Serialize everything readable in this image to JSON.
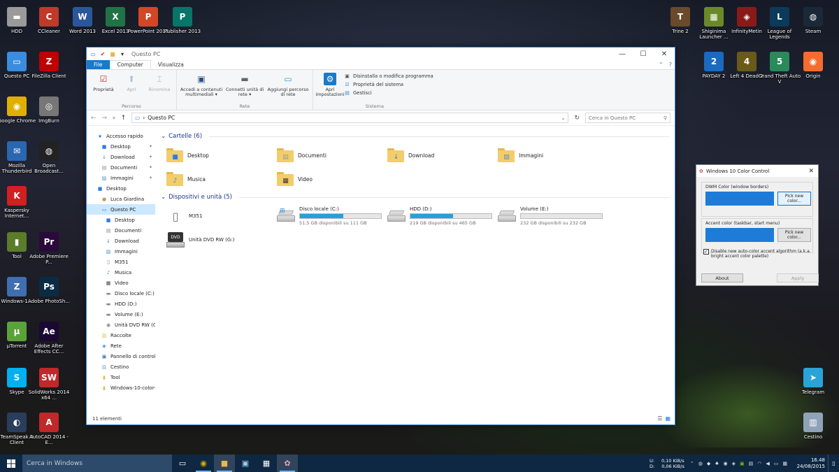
{
  "desktop": {
    "left_icons": [
      {
        "label": "HDD",
        "color": "#9a9a9a",
        "glyph": "▬"
      },
      {
        "label": "CCleaner",
        "color": "#c0392b",
        "glyph": "C"
      },
      {
        "label": "Word 2013",
        "color": "#2b579a",
        "glyph": "W"
      },
      {
        "label": "Excel 2013",
        "color": "#217346",
        "glyph": "X"
      },
      {
        "label": "PowerPoint 2013",
        "color": "#d24726",
        "glyph": "P"
      },
      {
        "label": "Publisher 2013",
        "color": "#077568",
        "glyph": "P"
      },
      {
        "label": "Questo PC",
        "color": "#3a8dde",
        "glyph": "▭"
      },
      {
        "label": "FileZilla Client",
        "color": "#bf0000",
        "glyph": "Z"
      },
      {
        "label": "Google Chrome",
        "color": "#e0b000",
        "glyph": "◉"
      },
      {
        "label": "ImgBurn",
        "color": "#777",
        "glyph": "◎"
      },
      {
        "label": "Mozilla Thunderbird",
        "color": "#2a67b1",
        "glyph": "✉"
      },
      {
        "label": "Open Broadcast...",
        "color": "#222",
        "glyph": "◍"
      },
      {
        "label": "Kaspersky Internet...",
        "color": "#d02020",
        "glyph": "K"
      },
      {
        "label": "Tool",
        "color": "#5b7c2a",
        "glyph": "▮"
      },
      {
        "label": "Adobe Premiere P...",
        "color": "#2a0a3a",
        "glyph": "Pr"
      },
      {
        "label": "Windows-1...",
        "color": "#3f6fb0",
        "glyph": "Z"
      },
      {
        "label": "Adobe PhotoSh...",
        "color": "#0b2a44",
        "glyph": "Ps"
      },
      {
        "label": "µTorrent",
        "color": "#5aa33a",
        "glyph": "µ"
      },
      {
        "label": "Adobe After Effects CC...",
        "color": "#1a0a33",
        "glyph": "Ae"
      },
      {
        "label": "Skype",
        "color": "#00aff0",
        "glyph": "S"
      },
      {
        "label": "SolidWorks 2014 x64 ...",
        "color": "#c0282a",
        "glyph": "SW"
      },
      {
        "label": "TeamSpeak 3 Client",
        "color": "#2a3d5c",
        "glyph": "◐"
      },
      {
        "label": "AutoCAD 2014 - E...",
        "color": "#c0282a",
        "glyph": "A"
      }
    ],
    "right_icons": [
      {
        "label": "Trine 2",
        "color": "#6a4a2a",
        "glyph": "T"
      },
      {
        "label": "Shiginima Launcher ...",
        "color": "#6a8a2a",
        "glyph": "▦"
      },
      {
        "label": "InfinityMetin",
        "color": "#8a1a1a",
        "glyph": "◈"
      },
      {
        "label": "League of Legends",
        "color": "#0b3a5a",
        "glyph": "L"
      },
      {
        "label": "Steam",
        "color": "#1b2838",
        "glyph": "◍"
      },
      {
        "label": "PAYDAY 2",
        "color": "#1a6ac0",
        "glyph": "2"
      },
      {
        "label": "Left 4 Dead 2",
        "color": "#6a5a1a",
        "glyph": "4"
      },
      {
        "label": "Grand Theft Auto V",
        "color": "#2a8a5a",
        "glyph": "5"
      },
      {
        "label": "Origin",
        "color": "#f56c2d",
        "glyph": "◉"
      },
      {
        "label": "Telegram",
        "color": "#2aa3d9",
        "glyph": "➤"
      },
      {
        "label": "Cestino",
        "color": "#8fa3b8",
        "glyph": "▥"
      }
    ]
  },
  "explorer": {
    "title": "Questo PC",
    "tabs": {
      "file": "File",
      "computer": "Computer",
      "view": "Visualizza"
    },
    "ribbon": {
      "groups": [
        {
          "label": "Percorso",
          "buttons": [
            {
              "label": "Proprietà",
              "icon": "properties-icon",
              "disabled": false
            },
            {
              "label": "Apri",
              "icon": "open-icon",
              "disabled": true
            },
            {
              "label": "Rinomina",
              "icon": "rename-icon",
              "disabled": true
            }
          ]
        },
        {
          "label": "Rete",
          "buttons": [
            {
              "label": "Accedi a contenuti multimediali ▾",
              "icon": "media-icon",
              "disabled": false
            },
            {
              "label": "Connetti unità di rete ▾",
              "icon": "network-drive-icon",
              "disabled": false
            },
            {
              "label": "Aggiungi percorso di rete",
              "icon": "network-location-icon",
              "disabled": false
            }
          ]
        },
        {
          "label": "Sistema",
          "buttons": [
            {
              "label": "Apri impostazioni",
              "icon": "settings-icon",
              "disabled": false
            }
          ]
        }
      ],
      "system_items": [
        "Disinstalla o modifica programma",
        "Proprietà del sistema",
        "Gestisci"
      ]
    },
    "address": {
      "path": "Questo PC",
      "search_placeholder": "Cerca in Questo PC"
    },
    "nav": [
      {
        "label": "Accesso rapido",
        "indent": 0,
        "icon": "★",
        "color": "#2b7de9",
        "pin": false
      },
      {
        "label": "Desktop",
        "indent": 1,
        "icon": "■",
        "color": "#2b7de9",
        "pin": true
      },
      {
        "label": "Download",
        "indent": 1,
        "icon": "↓",
        "color": "#2b7de9",
        "pin": true
      },
      {
        "label": "Documenti",
        "indent": 1,
        "icon": "▤",
        "color": "#888",
        "pin": true
      },
      {
        "label": "Immagini",
        "indent": 1,
        "icon": "▨",
        "color": "#5a8fc0",
        "pin": true
      },
      {
        "label": "Desktop",
        "indent": 0,
        "icon": "■",
        "color": "#2b7de9",
        "pin": false
      },
      {
        "label": "Luca Giardina",
        "indent": 1,
        "icon": "●",
        "color": "#c59a5a",
        "pin": false
      },
      {
        "label": "Questo PC",
        "indent": 1,
        "icon": "▭",
        "color": "#2b7de9",
        "pin": false,
        "selected": true
      },
      {
        "label": "Desktop",
        "indent": 2,
        "icon": "■",
        "color": "#2b7de9",
        "pin": false
      },
      {
        "label": "Documenti",
        "indent": 2,
        "icon": "▤",
        "color": "#888",
        "pin": false
      },
      {
        "label": "Download",
        "indent": 2,
        "icon": "↓",
        "color": "#2b7de9",
        "pin": false
      },
      {
        "label": "Immagini",
        "indent": 2,
        "icon": "▨",
        "color": "#5a8fc0",
        "pin": false
      },
      {
        "label": "M351",
        "indent": 2,
        "icon": "▯",
        "color": "#777",
        "pin": false
      },
      {
        "label": "Musica",
        "indent": 2,
        "icon": "♪",
        "color": "#2b7de9",
        "pin": false
      },
      {
        "label": "Video",
        "indent": 2,
        "icon": "▦",
        "color": "#444",
        "pin": false
      },
      {
        "label": "Disco locale (C:)",
        "indent": 2,
        "icon": "▬",
        "color": "#888",
        "pin": false
      },
      {
        "label": "HDD (D:)",
        "indent": 2,
        "icon": "▬",
        "color": "#888",
        "pin": false
      },
      {
        "label": "Volume (E:)",
        "indent": 2,
        "icon": "▬",
        "color": "#888",
        "pin": false
      },
      {
        "label": "Unità DVD RW (G:)",
        "indent": 2,
        "icon": "◉",
        "color": "#888",
        "pin": false
      },
      {
        "label": "Raccolte",
        "indent": 1,
        "icon": "▥",
        "color": "#e8b84e",
        "pin": false
      },
      {
        "label": "Rete",
        "indent": 1,
        "icon": "◈",
        "color": "#2b7de9",
        "pin": false
      },
      {
        "label": "Pannello di controll",
        "indent": 1,
        "icon": "▣",
        "color": "#4a7db0",
        "pin": false
      },
      {
        "label": "Cestino",
        "indent": 1,
        "icon": "▥",
        "color": "#8fa3b8",
        "pin": false
      },
      {
        "label": "Tool",
        "indent": 1,
        "icon": "▮",
        "color": "#e8b84e",
        "pin": false
      },
      {
        "label": "Windows-10-color-",
        "indent": 1,
        "icon": "▮",
        "color": "#e8b84e",
        "pin": false
      }
    ],
    "folders_header": "Cartelle (6)",
    "folders": [
      {
        "label": "Desktop",
        "overlay": "■",
        "ocolor": "#2b7de9"
      },
      {
        "label": "Documenti",
        "overlay": "▤",
        "ocolor": "#9a9a9a"
      },
      {
        "label": "Download",
        "overlay": "↓",
        "ocolor": "#2b7de9"
      },
      {
        "label": "Immagini",
        "overlay": "▨",
        "ocolor": "#5a8fc0"
      },
      {
        "label": "Musica",
        "overlay": "♪",
        "ocolor": "#2b7de9"
      },
      {
        "label": "Video",
        "overlay": "▦",
        "ocolor": "#333"
      }
    ],
    "devices_header": "Dispositivi e unità (5)",
    "devices": [
      {
        "label": "M351",
        "type": "phone",
        "sub": "",
        "used": null
      },
      {
        "label": "Disco locale (C:)",
        "type": "system",
        "sub": "51,5 GB disponibili su 111 GB",
        "used": 0.536
      },
      {
        "label": "HDD (D:)",
        "type": "hdd",
        "sub": "219 GB disponibili su 465 GB",
        "used": 0.529
      },
      {
        "label": "Volume (E:)",
        "type": "hdd",
        "sub": "232 GB disponibili su 232 GB",
        "used": 0.0
      },
      {
        "label": "Unità DVD RW (G:)",
        "type": "dvd",
        "sub": "",
        "used": null
      }
    ],
    "status": "11 elementi"
  },
  "color_control": {
    "title": "Windows 10 Color Control",
    "dwm_label": "DWM Color (window borders)",
    "accent_label": "Accent color (taskbar, start menu)",
    "pick_label": "Pick new color...",
    "checkbox_label": "Disable new auto-color accent algorithm (a.k.a. bright accent color palette)",
    "checked": true,
    "about": "About",
    "apply": "Apply",
    "swatch_color": "#1e7bd8"
  },
  "taskbar": {
    "search_placeholder": "Cerca in Windows",
    "net_up_label": "U:",
    "net_down_label": "D:",
    "net_up": "0,10 KiB/s",
    "net_down": "0,06 KiB/s",
    "time": "16.48",
    "date": "24/08/2015"
  }
}
